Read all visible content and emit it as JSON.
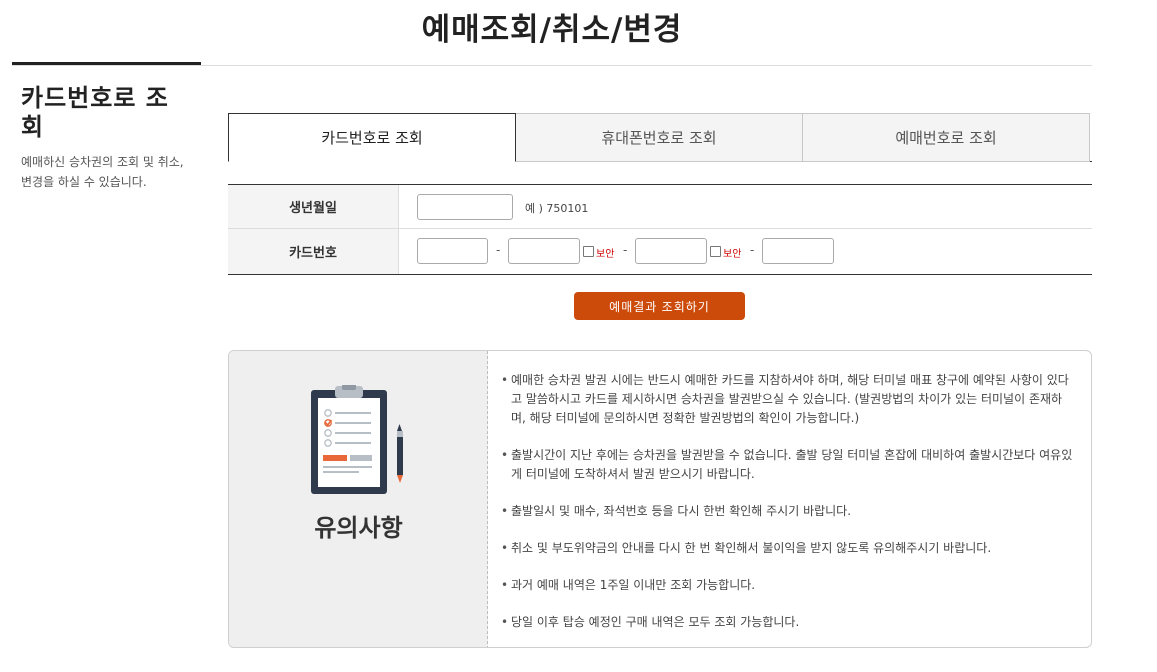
{
  "page": {
    "title": "예매조회/취소/변경"
  },
  "sidebar": {
    "title": "카드번호로 조회",
    "description": "예매하신 승차권의 조회 및 취소, 변경을 하실 수 있습니다."
  },
  "tabs": [
    {
      "label": "카드번호로 조회",
      "active": true
    },
    {
      "label": "휴대폰번호로 조회",
      "active": false
    },
    {
      "label": "예매번호로 조회",
      "active": false
    }
  ],
  "form": {
    "birth": {
      "label": "생년월일",
      "value": "",
      "hint": "예 ) 750101"
    },
    "card": {
      "label": "카드번호",
      "parts": [
        "",
        "",
        "",
        ""
      ],
      "separator": "-",
      "secure_label": "보안"
    }
  },
  "search_button": {
    "label": "예매결과 조회하기"
  },
  "notice": {
    "heading": "유의사항",
    "items": [
      "예매한 승차권 발권 시에는 반드시 예매한 카드를 지참하셔야 하며, 해당 터미널 매표 창구에 예약된 사항이 있다고 말씀하시고 카드를 제시하시면 승차권을 발권받으실 수 있습니다. (발권방법의 차이가 있는 터미널이 존재하며, 해당 터미널에 문의하시면 정확한 발권방법의 확인이 가능합니다.)",
      "출발시간이 지난 후에는 승차권을 발권받을 수 없습니다. 출발 당일 터미널 혼잡에 대비하여 출발시간보다 여유있게 터미널에 도착하셔서 발권 받으시기 바랍니다.",
      "출발일시 및 매수, 좌석번호 등을 다시 한번 확인해 주시기 바랍니다.",
      "취소 및 부도위약금의 안내를 다시 한 번 확인해서 불이익을 받지 않도록 유의해주시기 바랍니다.",
      "과거 예매 내역은 1주일 이내만 조회 가능합니다.",
      "당일 이후 탑승 예정인 구매 내역은 모두 조회 가능합니다."
    ]
  },
  "colors": {
    "accent": "#cc4a0a",
    "secure": "#cc0000",
    "icon_navy": "#2f3b4c",
    "icon_orange": "#e8683a"
  },
  "icons": {
    "notice": "clipboard-checklist-icon",
    "pencil": "pencil-icon"
  }
}
